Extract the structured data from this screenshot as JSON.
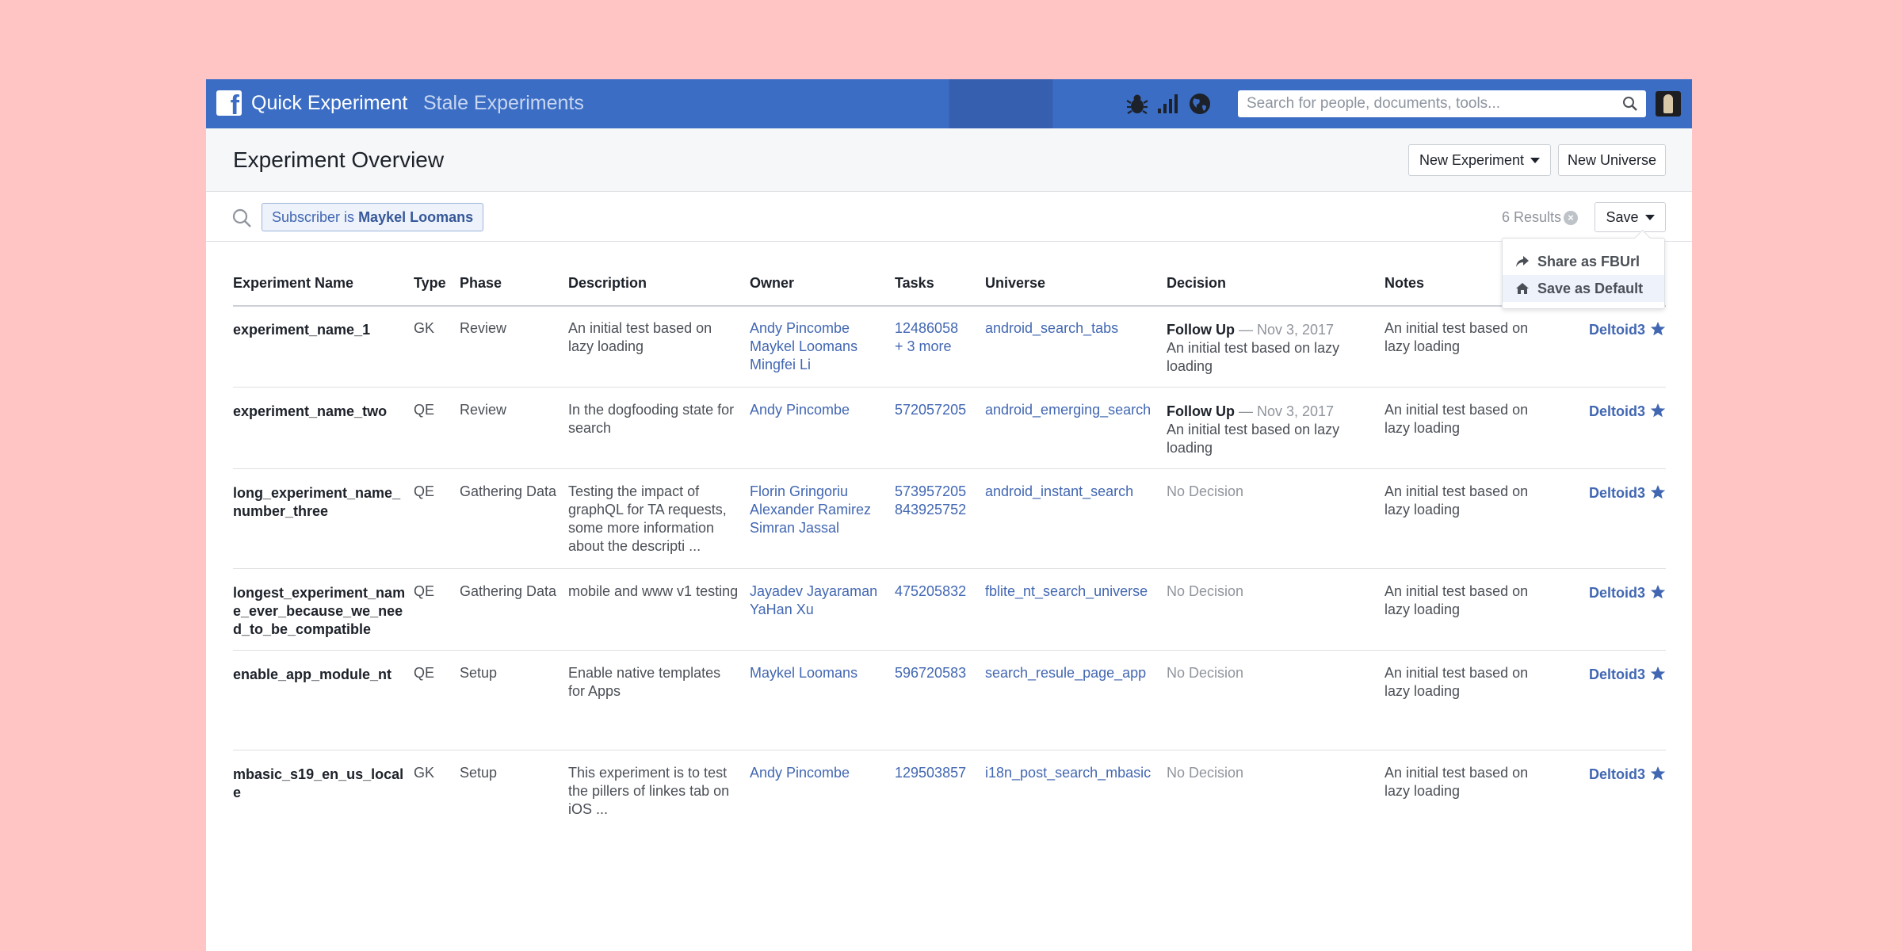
{
  "colors": {
    "background": "#ffc4c4",
    "topbar": "#3b6dc4",
    "link": "#4267b2",
    "muted": "#90949c"
  },
  "topbar": {
    "logo_icon": "facebook-f-icon",
    "title": "Quick Experiment",
    "subtitle": "Stale Experiments",
    "icons": [
      "bug-icon",
      "signal-bars-icon",
      "globe-icon"
    ],
    "search_placeholder": "Search for people, documents, tools..."
  },
  "header": {
    "title": "Experiment Overview",
    "new_experiment_label": "New Experiment",
    "new_universe_label": "New Universe"
  },
  "filter": {
    "token_prefix": "Subscriber is",
    "token_value": "Maykel Loomans",
    "results": "6 Results",
    "save_label": "Save"
  },
  "save_menu": {
    "items": [
      {
        "label": "Share as FBUrl",
        "icon": "share-arrow-icon"
      },
      {
        "label": "Save as Default",
        "icon": "home-icon"
      }
    ]
  },
  "table": {
    "columns": [
      "Experiment Name",
      "Type",
      "Phase",
      "Description",
      "Owner",
      "Tasks",
      "Universe",
      "Decision",
      "Notes"
    ],
    "rows": [
      {
        "name": "experiment_name_1",
        "type": "GK",
        "phase": "Review",
        "description": "An initial test based on lazy loading",
        "owners": [
          "Andy Pincombe",
          "Maykel Loomans",
          "Mingfei Li"
        ],
        "tasks": [
          "12486058",
          "+ 3 more"
        ],
        "universe": "android_search_tabs",
        "decision_title": "Follow Up",
        "decision_date": "— Nov 3, 2017",
        "decision_text": "An initial test based on lazy loading",
        "notes": "An initial test based on lazy loading",
        "deltoid": "Deltoid3"
      },
      {
        "name": "experiment_name_two",
        "type": "QE",
        "phase": "Review",
        "description": "In the dogfooding state for search",
        "owners": [
          "Andy Pincombe"
        ],
        "tasks": [
          "572057205"
        ],
        "universe": "android_emerging_search",
        "decision_title": "Follow Up",
        "decision_date": "— Nov 3, 2017",
        "decision_text": "An initial test based on lazy loading",
        "notes": "An initial test based on lazy loading",
        "deltoid": "Deltoid3"
      },
      {
        "name": "long_experiment_name_number_three",
        "type": "QE",
        "phase": "Gathering Data",
        "description": "Testing the impact of graphQL for TA requests, some more information about the descripti ...",
        "owners": [
          "Florin Gringoriu",
          "Alexander Ramirez",
          "Simran Jassal"
        ],
        "tasks": [
          "573957205",
          "843925752"
        ],
        "universe": "android_instant_search",
        "decision": "No Decision",
        "notes": "An initial test based on lazy loading",
        "deltoid": "Deltoid3"
      },
      {
        "name": "longest_experiment_name_ever_because_we_need_to_be_compatible",
        "type": "QE",
        "phase": "Gathering Data",
        "description": "mobile and www v1 testing",
        "owners": [
          "Jayadev Jayaraman",
          "YaHan Xu"
        ],
        "tasks": [
          "475205832"
        ],
        "universe": "fblite_nt_search_universe",
        "decision": "No Decision",
        "notes": "An initial test based on lazy loading",
        "deltoid": "Deltoid3"
      },
      {
        "name": "enable_app_module_nt",
        "type": "QE",
        "phase": "Setup",
        "description": "Enable native templates for Apps",
        "owners": [
          "Maykel Loomans"
        ],
        "tasks": [
          "596720583"
        ],
        "universe": "search_resule_page_app",
        "decision": "No Decision",
        "notes": "An initial test based on lazy loading",
        "deltoid": "Deltoid3"
      },
      {
        "name": "mbasic_s19_en_us_locale",
        "type": "GK",
        "phase": "Setup",
        "description": "This experiment is to test the pillers of linkes tab on iOS ...",
        "owners": [
          "Andy Pincombe"
        ],
        "tasks": [
          "129503857"
        ],
        "universe": "i18n_post_search_mbasic",
        "decision": "No Decision",
        "notes": "An initial test based on lazy loading",
        "deltoid": "Deltoid3"
      }
    ]
  }
}
